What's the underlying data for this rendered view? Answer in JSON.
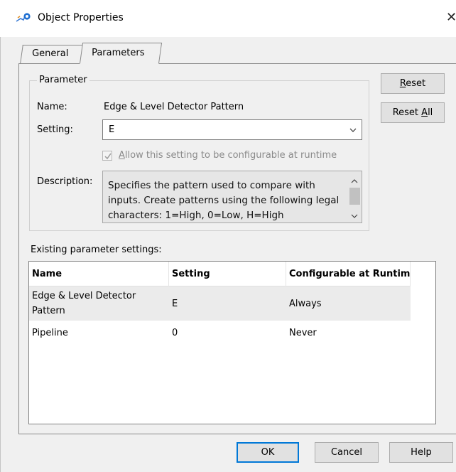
{
  "window": {
    "title": "Object Properties",
    "close_glyph": "✕"
  },
  "tabs": [
    {
      "label": "General",
      "active": false
    },
    {
      "label": "Parameters",
      "active": true
    }
  ],
  "parameter_group": {
    "title": "Parameter",
    "name_label": "Name:",
    "name_value": "Edge & Level Detector Pattern",
    "setting_label": "Setting:",
    "setting_value": "E",
    "runtime_checkbox_label": "Allow this setting to be configurable at runtime",
    "runtime_checkbox_checked": true,
    "runtime_checkbox_enabled": false,
    "description_label": "Description:",
    "description_text": "Specifies the pattern used to compare with inputs. Create patterns using the following legal characters: 1=High, 0=Low, H=High"
  },
  "side_buttons": {
    "reset": "Reset",
    "reset_all": "Reset All"
  },
  "existing_settings": {
    "label": "Existing parameter settings:",
    "columns": [
      "Name",
      "Setting",
      "Configurable at Runtim"
    ],
    "rows": [
      {
        "name": "Edge & Level Detector Pattern",
        "setting": "E",
        "configurable": "Always",
        "selected": true
      },
      {
        "name": "Pipeline",
        "setting": "0",
        "configurable": "Never",
        "selected": false
      }
    ]
  },
  "footer_buttons": {
    "ok": "OK",
    "cancel": "Cancel",
    "help": "Help"
  },
  "colors": {
    "default_button_border": "#0078d7",
    "row_highlight": "#ebebeb",
    "dialog_bg": "#f0f0f0"
  }
}
